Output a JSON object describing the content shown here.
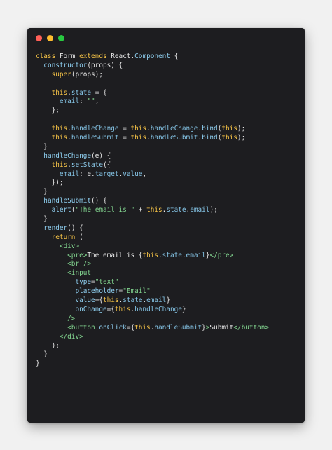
{
  "window": {
    "controls": [
      {
        "name": "close",
        "color": "#ff5f57"
      },
      {
        "name": "minimize",
        "color": "#febc2e"
      },
      {
        "name": "maximize",
        "color": "#28c840"
      }
    ]
  },
  "colors": {
    "keyword": "#f7c447",
    "this": "#f7c447",
    "func": "#8fcff0",
    "string": "#82d48f",
    "property": "#86c6e8",
    "tag": "#82d48f",
    "attr": "#8fcff0",
    "default": "#e8e8e8"
  },
  "code": [
    [
      [
        "class ",
        "keyword"
      ],
      [
        "Form ",
        "default"
      ],
      [
        "extends ",
        "keyword"
      ],
      [
        "React",
        "default"
      ],
      [
        ".",
        "default"
      ],
      [
        "Component",
        "func"
      ],
      [
        " {",
        "default"
      ]
    ],
    [
      [
        "  ",
        "default"
      ],
      [
        "constructor",
        "func"
      ],
      [
        "(props) {",
        "default"
      ]
    ],
    [
      [
        "    ",
        "default"
      ],
      [
        "super",
        "keyword"
      ],
      [
        "(props);",
        "default"
      ]
    ],
    [
      [
        "",
        "default"
      ]
    ],
    [
      [
        "    ",
        "default"
      ],
      [
        "this",
        "this"
      ],
      [
        ".",
        "default"
      ],
      [
        "state",
        "property"
      ],
      [
        " = {",
        "default"
      ]
    ],
    [
      [
        "      ",
        "default"
      ],
      [
        "email",
        "property"
      ],
      [
        ": ",
        "default"
      ],
      [
        "\"\"",
        "string"
      ],
      [
        ",",
        "default"
      ]
    ],
    [
      [
        "    };",
        "default"
      ]
    ],
    [
      [
        "",
        "default"
      ]
    ],
    [
      [
        "    ",
        "default"
      ],
      [
        "this",
        "this"
      ],
      [
        ".",
        "default"
      ],
      [
        "handleChange",
        "property"
      ],
      [
        " = ",
        "default"
      ],
      [
        "this",
        "this"
      ],
      [
        ".",
        "default"
      ],
      [
        "handleChange",
        "property"
      ],
      [
        ".",
        "default"
      ],
      [
        "bind",
        "func"
      ],
      [
        "(",
        "default"
      ],
      [
        "this",
        "this"
      ],
      [
        ");",
        "default"
      ]
    ],
    [
      [
        "    ",
        "default"
      ],
      [
        "this",
        "this"
      ],
      [
        ".",
        "default"
      ],
      [
        "handleSubmit",
        "property"
      ],
      [
        " = ",
        "default"
      ],
      [
        "this",
        "this"
      ],
      [
        ".",
        "default"
      ],
      [
        "handleSubmit",
        "property"
      ],
      [
        ".",
        "default"
      ],
      [
        "bind",
        "func"
      ],
      [
        "(",
        "default"
      ],
      [
        "this",
        "this"
      ],
      [
        ");",
        "default"
      ]
    ],
    [
      [
        "  }",
        "default"
      ]
    ],
    [
      [
        "  ",
        "default"
      ],
      [
        "handleChange",
        "func"
      ],
      [
        "(e) {",
        "default"
      ]
    ],
    [
      [
        "    ",
        "default"
      ],
      [
        "this",
        "this"
      ],
      [
        ".",
        "default"
      ],
      [
        "setState",
        "func"
      ],
      [
        "({",
        "default"
      ]
    ],
    [
      [
        "      ",
        "default"
      ],
      [
        "email",
        "property"
      ],
      [
        ": e.",
        "default"
      ],
      [
        "target",
        "property"
      ],
      [
        ".",
        "default"
      ],
      [
        "value",
        "property"
      ],
      [
        ",",
        "default"
      ]
    ],
    [
      [
        "    });",
        "default"
      ]
    ],
    [
      [
        "  }",
        "default"
      ]
    ],
    [
      [
        "  ",
        "default"
      ],
      [
        "handleSubmit",
        "func"
      ],
      [
        "() {",
        "default"
      ]
    ],
    [
      [
        "    ",
        "default"
      ],
      [
        "alert",
        "func"
      ],
      [
        "(",
        "default"
      ],
      [
        "\"The email is \"",
        "string"
      ],
      [
        " + ",
        "default"
      ],
      [
        "this",
        "this"
      ],
      [
        ".",
        "default"
      ],
      [
        "state",
        "property"
      ],
      [
        ".",
        "default"
      ],
      [
        "email",
        "property"
      ],
      [
        ");",
        "default"
      ]
    ],
    [
      [
        "  }",
        "default"
      ]
    ],
    [
      [
        "  ",
        "default"
      ],
      [
        "render",
        "func"
      ],
      [
        "() {",
        "default"
      ]
    ],
    [
      [
        "    ",
        "default"
      ],
      [
        "return",
        "keyword"
      ],
      [
        " (",
        "default"
      ]
    ],
    [
      [
        "      ",
        "default"
      ],
      [
        "<div>",
        "tag"
      ]
    ],
    [
      [
        "        ",
        "default"
      ],
      [
        "<pre>",
        "tag"
      ],
      [
        "The email is {",
        "default"
      ],
      [
        "this",
        "this"
      ],
      [
        ".",
        "default"
      ],
      [
        "state",
        "property"
      ],
      [
        ".",
        "default"
      ],
      [
        "email",
        "property"
      ],
      [
        "}",
        "default"
      ],
      [
        "</pre>",
        "tag"
      ]
    ],
    [
      [
        "        ",
        "default"
      ],
      [
        "<br />",
        "tag"
      ]
    ],
    [
      [
        "        ",
        "default"
      ],
      [
        "<input",
        "tag"
      ]
    ],
    [
      [
        "          ",
        "default"
      ],
      [
        "type",
        "attr"
      ],
      [
        "=",
        "default"
      ],
      [
        "\"text\"",
        "string"
      ]
    ],
    [
      [
        "          ",
        "default"
      ],
      [
        "placeholder",
        "attr"
      ],
      [
        "=",
        "default"
      ],
      [
        "\"Email\"",
        "string"
      ]
    ],
    [
      [
        "          ",
        "default"
      ],
      [
        "value",
        "attr"
      ],
      [
        "={",
        "default"
      ],
      [
        "this",
        "this"
      ],
      [
        ".",
        "default"
      ],
      [
        "state",
        "property"
      ],
      [
        ".",
        "default"
      ],
      [
        "email",
        "property"
      ],
      [
        "}",
        "default"
      ]
    ],
    [
      [
        "          ",
        "default"
      ],
      [
        "onChange",
        "attr"
      ],
      [
        "={",
        "default"
      ],
      [
        "this",
        "this"
      ],
      [
        ".",
        "default"
      ],
      [
        "handleChange",
        "property"
      ],
      [
        "}",
        "default"
      ]
    ],
    [
      [
        "        ",
        "default"
      ],
      [
        "/>",
        "tag"
      ]
    ],
    [
      [
        "        ",
        "default"
      ],
      [
        "<button ",
        "tag"
      ],
      [
        "onClick",
        "attr"
      ],
      [
        "={",
        "default"
      ],
      [
        "this",
        "this"
      ],
      [
        ".",
        "default"
      ],
      [
        "handleSubmit",
        "property"
      ],
      [
        "}",
        "default"
      ],
      [
        ">",
        "tag"
      ],
      [
        "Submit",
        "default"
      ],
      [
        "</button>",
        "tag"
      ]
    ],
    [
      [
        "      ",
        "default"
      ],
      [
        "</div>",
        "tag"
      ]
    ],
    [
      [
        "    );",
        "default"
      ]
    ],
    [
      [
        "  }",
        "default"
      ]
    ],
    [
      [
        "}",
        "default"
      ]
    ]
  ]
}
